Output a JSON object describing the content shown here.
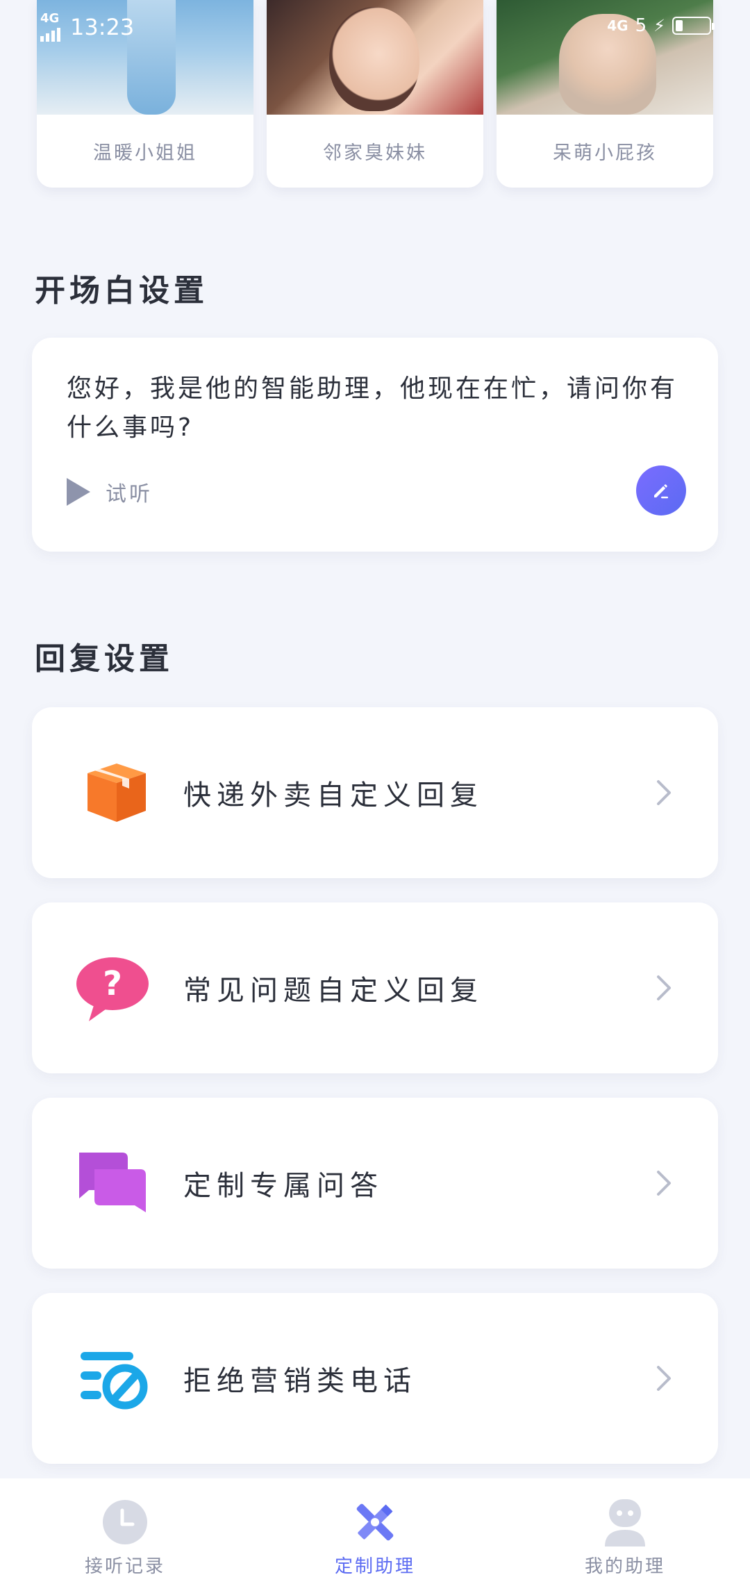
{
  "status_bar": {
    "left_network": "4G",
    "time": "13:23",
    "right_network": "4G",
    "battery_text": "5"
  },
  "voice_cards": [
    {
      "name": "温暖小姐姐"
    },
    {
      "name": "邻家臭妹妹"
    },
    {
      "name": "呆萌小屁孩"
    }
  ],
  "greeting": {
    "section_title": "开场白设置",
    "text": "您好，我是他的智能助理，他现在在忙，请问你有什么事吗?",
    "listen_label": "试听"
  },
  "reply": {
    "section_title": "回复设置",
    "items": [
      {
        "label": "快递外卖自定义回复",
        "icon": "package-icon",
        "color": "#f7792a"
      },
      {
        "label": "常见问题自定义回复",
        "icon": "question-bubble-icon",
        "color": "#ef4f8f"
      },
      {
        "label": "定制专属问答",
        "icon": "chat-bubbles-icon",
        "color": "#b44fd8"
      },
      {
        "label": "拒绝营销类电话",
        "icon": "block-list-icon",
        "color": "#1ba7e8"
      }
    ]
  },
  "bottom_nav": [
    {
      "label": "接听记录",
      "icon": "clock-icon",
      "active": false
    },
    {
      "label": "定制助理",
      "icon": "tools-icon",
      "active": true
    },
    {
      "label": "我的助理",
      "icon": "robot-icon",
      "active": false
    }
  ],
  "colors": {
    "accent": "#5b6bf2",
    "background": "#f3f5fb",
    "muted_text": "#8a8fa3"
  }
}
